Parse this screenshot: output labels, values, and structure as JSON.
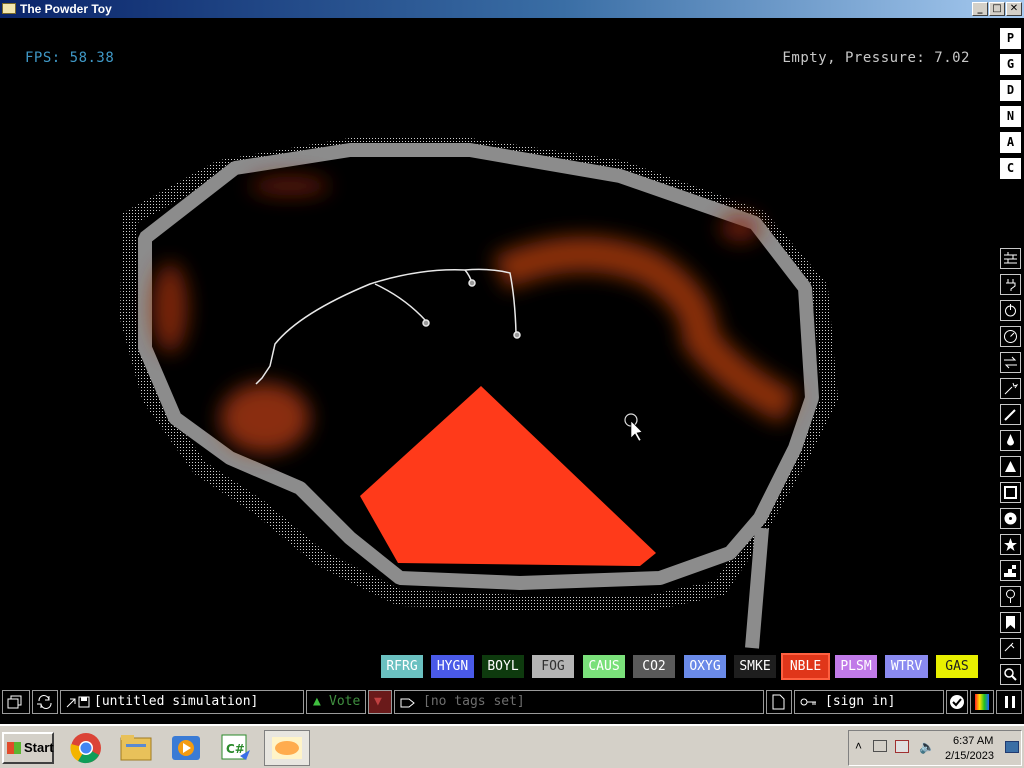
{
  "window": {
    "title": "The Powder Toy",
    "controls": [
      "_",
      "□",
      "✕"
    ]
  },
  "hud": {
    "fps": "FPS: 58.38",
    "status": "Empty, Pressure: 7.02"
  },
  "right_menu": {
    "letters": [
      "P",
      "G",
      "D",
      "N",
      "A",
      "C"
    ],
    "icons": [
      "wall-icon",
      "electronics-icon",
      "power-icon",
      "sensor-icon",
      "force-icon",
      "explosives-icon",
      "gases-icon",
      "liquids-icon",
      "powders-icon",
      "solids-icon",
      "radioactive-icon",
      "special-icon",
      "life-icon",
      "tools-icon",
      "favorites-icon",
      "decoration-icon",
      "search-icon"
    ]
  },
  "elements": [
    {
      "label": "RFRG",
      "bg": "#6ac0c0",
      "fg": "#ffffff"
    },
    {
      "label": "HYGN",
      "bg": "#4a5ae8",
      "fg": "#ffffff"
    },
    {
      "label": "BOYL",
      "bg": "#0e3a0e",
      "fg": "#ffffff"
    },
    {
      "label": "FOG",
      "bg": "#b4b4b4",
      "fg": "#303030"
    },
    {
      "label": "CAUS",
      "bg": "#7ae07a",
      "fg": "#ffffff"
    },
    {
      "label": "CO2",
      "bg": "#5a5a5a",
      "fg": "#ffffff"
    },
    {
      "label": "OXYG",
      "bg": "#6a8ae8",
      "fg": "#ffffff"
    },
    {
      "label": "SMKE",
      "bg": "#1e1e1e",
      "fg": "#ffffff"
    },
    {
      "label": "NBLE",
      "bg": "#e0361a",
      "fg": "#ffffff",
      "selected": true
    },
    {
      "label": "PLSM",
      "bg": "#c07ae8",
      "fg": "#ffffff"
    },
    {
      "label": "WTRV",
      "bg": "#8a8af0",
      "fg": "#ffffff"
    },
    {
      "label": "GAS",
      "bg": "#e8f000",
      "fg": "#202020"
    }
  ],
  "toolbar": {
    "save_name": "[untitled simulation]",
    "vote": "Vote",
    "tags": "[no tags set]",
    "sign_in": "[sign in]"
  },
  "taskbar": {
    "start": "Start",
    "apps": [
      "chrome-icon",
      "explorer-icon",
      "media-player-icon",
      "csharp-icon",
      "powder-toy-icon"
    ],
    "time": "6:37 AM",
    "date": "2/15/2023"
  },
  "colors": {
    "accent_fps": "#3f98c6",
    "wall": "#8c8c8c",
    "noble_gas": "#ff3a1a",
    "vote_green": "#3fbf3f",
    "vote_down": "#c03030"
  }
}
